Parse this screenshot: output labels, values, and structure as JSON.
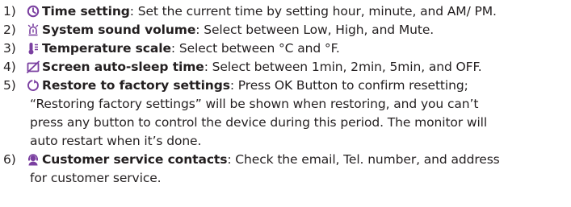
{
  "items": [
    {
      "number": "1)",
      "icon": "clock-icon",
      "title": "Time setting",
      "desc": ": Set the current time by setting hour, minute, and AM/ PM."
    },
    {
      "number": "2)",
      "icon": "alarm-bell-icon",
      "title": "System sound volume",
      "desc": ": Select between Low, High, and Mute."
    },
    {
      "number": "3)",
      "icon": "thermometer-icon",
      "title": "Temperature scale",
      "desc": ": Select between °C and °F."
    },
    {
      "number": "4)",
      "icon": "no-screen-icon",
      "title": "Screen auto-sleep time",
      "desc": ": Select between 1min, 2min, 5min, and OFF."
    },
    {
      "number": "5)",
      "icon": "restore-icon",
      "title": "Restore to factory settings",
      "desc": ": Press OK Button to confirm resetting;",
      "continuation": [
        "“Restoring factory settings” will be shown when restoring, and you can’t",
        "press any button to control the device during this period. The monitor will",
        "auto restart when it’s done."
      ]
    },
    {
      "number": "6)",
      "icon": "customer-service-icon",
      "title": "Customer service contacts",
      "desc": ": Check the email, Tel. number, and address",
      "continuation": [
        "for customer service."
      ]
    }
  ],
  "colors": {
    "accent": "#7a3fa0",
    "text": "#231f20"
  }
}
